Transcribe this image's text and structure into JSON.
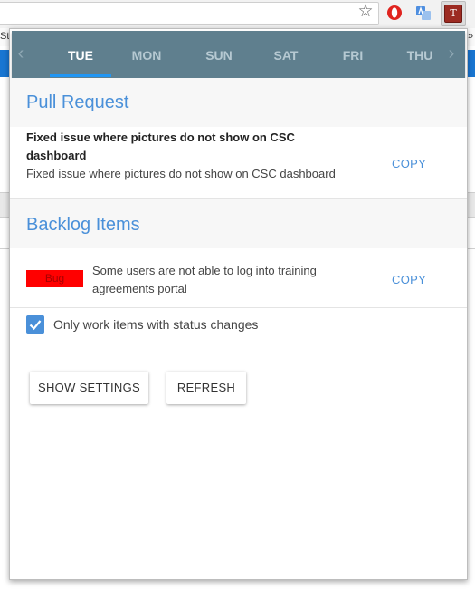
{
  "browser": {
    "bookmark_left_text": "St",
    "bookmark_right_text": "»",
    "extension_label": "T"
  },
  "popup": {
    "tabs": [
      {
        "label": "TUE",
        "active": true
      },
      {
        "label": "MON",
        "active": false
      },
      {
        "label": "SUN",
        "active": false
      },
      {
        "label": "SAT",
        "active": false
      },
      {
        "label": "FRI",
        "active": false
      },
      {
        "label": "THU",
        "active": false
      }
    ],
    "pull_request": {
      "title": "Pull Request",
      "item_title": "Fixed issue where pictures do not show on CSC dashboard",
      "item_description": "Fixed issue where pictures do not show on CSC dashboard",
      "copy_label": "COPY"
    },
    "backlog": {
      "title": "Backlog Items",
      "item_type": "Bug",
      "item_description": "Some users are not able to log into training agreements portal",
      "copy_label": "COPY"
    },
    "filter": {
      "checked": true,
      "label": "Only work items with status changes"
    },
    "buttons": {
      "show_settings": "SHOW SETTINGS",
      "refresh": "REFRESH"
    }
  },
  "colors": {
    "tab_bar": "#5f7f8e",
    "accent": "#4a90d9",
    "bug_badge": "#ff0000"
  }
}
